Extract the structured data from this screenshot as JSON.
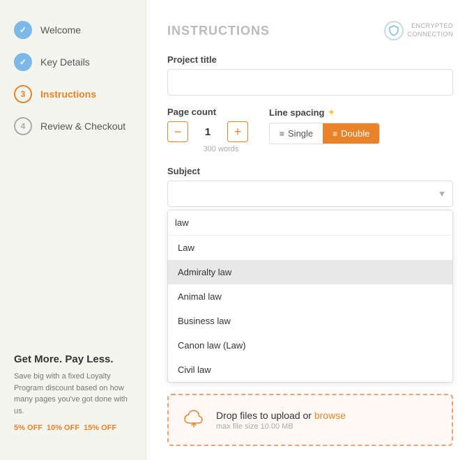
{
  "sidebar": {
    "steps": [
      {
        "id": "welcome",
        "number": "✓",
        "label": "Welcome",
        "state": "done"
      },
      {
        "id": "key-details",
        "number": "✓",
        "label": "Key Details",
        "state": "done"
      },
      {
        "id": "instructions",
        "number": "3",
        "label": "Instructions",
        "state": "active"
      },
      {
        "id": "review-checkout",
        "number": "4",
        "label": "Review & Checkout",
        "state": "pending"
      }
    ],
    "promo": {
      "title": "Get More. Pay Less.",
      "description": "Save big with a fixed Loyalty Program discount based on how many pages you've got done with us.",
      "badges": [
        "5% OFF",
        "10% OFF",
        "15% OFF"
      ]
    }
  },
  "main": {
    "section_title": "INSTRUCTIONS",
    "encrypted_label": "ENCRYPTED\nCONNECTION",
    "project_title_label": "Project title",
    "project_title_value": "",
    "project_title_placeholder": "",
    "page_count_label": "Page count",
    "page_count_value": "1",
    "page_count_sub": "300 words",
    "line_spacing_label": "Line spacing",
    "spacing_options": [
      {
        "id": "single",
        "label": "Single",
        "active": false
      },
      {
        "id": "double",
        "label": "Double",
        "active": true
      }
    ],
    "subject_label": "Subject",
    "subject_placeholder": "",
    "dropdown_search_value": "law",
    "dropdown_items": [
      {
        "id": "law",
        "label": "Law",
        "highlighted": false
      },
      {
        "id": "admiralty-law",
        "label": "Admiralty law",
        "highlighted": true
      },
      {
        "id": "animal-law",
        "label": "Animal law",
        "highlighted": false
      },
      {
        "id": "business-law",
        "label": "Business law",
        "highlighted": false
      },
      {
        "id": "canon-law",
        "label": "Canon law (Law)",
        "highlighted": false
      },
      {
        "id": "civil-law",
        "label": "Civil law",
        "highlighted": false
      }
    ],
    "upload_text": "Drop files to upload or ",
    "upload_link": "browse",
    "upload_sub": "max file size 10.00 MB",
    "counter_minus": "−",
    "counter_plus": "+",
    "single_icon": "≡",
    "double_icon": "≡"
  }
}
